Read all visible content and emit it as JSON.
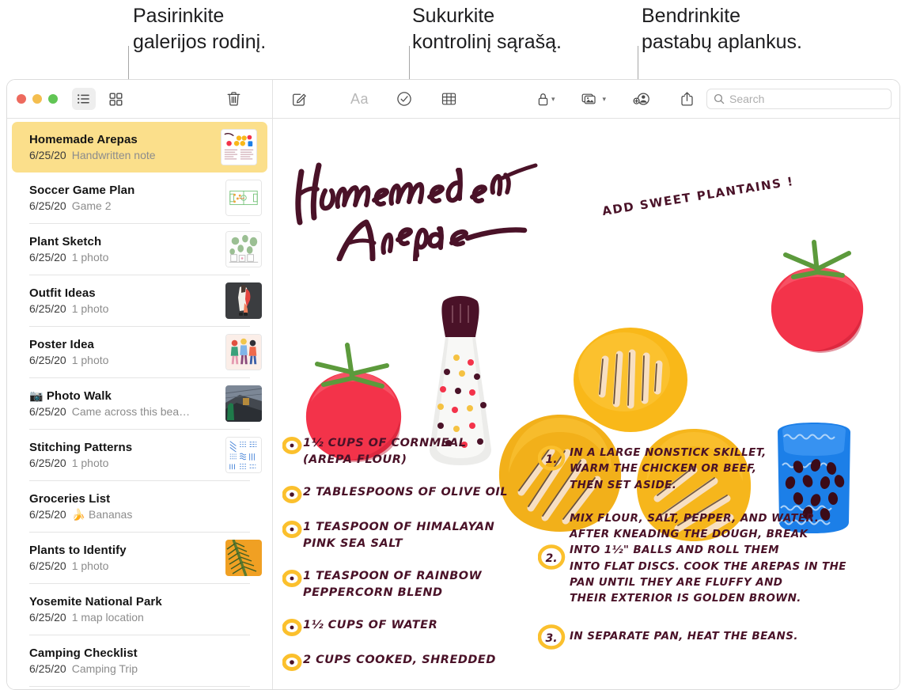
{
  "callouts": [
    {
      "id": "gallery",
      "text": "Pasirinkite\ngalerijos rodinį."
    },
    {
      "id": "checklist",
      "text": "Sukurkite\nkontrolinį sąrašą."
    },
    {
      "id": "share",
      "text": "Bendrinkite\npastabų aplankus."
    }
  ],
  "window": {
    "traffic_lights": [
      "close-red",
      "minimize-yellow",
      "zoom-green"
    ],
    "toolbar": {
      "list_view_label": "list-view",
      "gallery_view_label": "gallery-view",
      "delete_label": "delete-note",
      "compose_label": "new-note",
      "format_label": "Aa",
      "checklist_label": "checklist",
      "table_label": "table",
      "lock_label": "lock-note",
      "media_label": "media",
      "collaborate_label": "add-people",
      "share_label": "share",
      "search_placeholder": "Search",
      "search_value": ""
    }
  },
  "sidebar": {
    "notes": [
      {
        "title": "Homemade Arepas",
        "date": "6/25/20",
        "preview": "Handwritten note",
        "selected": true,
        "emoji": "",
        "thumb": "recipe"
      },
      {
        "title": "Soccer Game Plan",
        "date": "6/25/20",
        "preview": "Game 2",
        "selected": false,
        "emoji": "",
        "thumb": "soccer"
      },
      {
        "title": "Plant Sketch",
        "date": "6/25/20",
        "preview": "1 photo",
        "selected": false,
        "emoji": "",
        "thumb": "plants"
      },
      {
        "title": "Outfit Ideas",
        "date": "6/25/20",
        "preview": "1 photo",
        "selected": false,
        "emoji": "",
        "thumb": "outfit"
      },
      {
        "title": "Poster Idea",
        "date": "6/25/20",
        "preview": "1 photo",
        "selected": false,
        "emoji": "",
        "thumb": "poster"
      },
      {
        "title": "Photo Walk",
        "date": "6/25/20",
        "preview": "Came across this bea…",
        "selected": false,
        "emoji": "📷",
        "thumb": "photowalk"
      },
      {
        "title": "Stitching Patterns",
        "date": "6/25/20",
        "preview": "1 photo",
        "selected": false,
        "emoji": "",
        "thumb": "stitching"
      },
      {
        "title": "Groceries List",
        "date": "6/25/20",
        "preview": "Bananas",
        "selected": false,
        "emoji": "🍌",
        "thumb": ""
      },
      {
        "title": "Plants to Identify",
        "date": "6/25/20",
        "preview": "1 photo",
        "selected": false,
        "emoji": "",
        "thumb": "palm"
      },
      {
        "title": "Yosemite National Park",
        "date": "6/25/20",
        "preview": "1 map location",
        "selected": false,
        "emoji": "",
        "thumb": ""
      },
      {
        "title": "Camping Checklist",
        "date": "6/25/20",
        "preview": "Camping Trip",
        "selected": false,
        "emoji": "",
        "thumb": ""
      }
    ]
  },
  "note": {
    "title": "Homemade\nArepas",
    "annotation": "ADD SWEET\nPLANTAINS !",
    "ingredients": [
      "1½ CUPS OF CORNMEAL\n(AREPA FLOUR)",
      "2 TABLESPOONS OF OLIVE OIL",
      "1 TEASPOON OF HIMALAYAN\nPINK SEA SALT",
      "1 TEASPOON OF RAINBOW\nPEPPERCORN BLEND",
      "1½ CUPS OF WATER",
      "2 CUPS COOKED, SHREDDED"
    ],
    "steps": [
      {
        "num": "1.",
        "text": "IN A LARGE NONSTICK SKILLET,\nWARM THE CHICKEN OR BEEF,\nTHEN SET ASIDE."
      },
      {
        "num": "2.",
        "text": "MIX FLOUR, SALT, PEPPER, AND WATER.\nAFTER KNEADING THE DOUGH, BREAK\nINTO 1½\" BALLS AND ROLL THEM\nINTO FLAT DISCS. COOK THE AREPAS IN THE\nPAN UNTIL THEY ARE FLUFFY AND\nTHEIR EXTERIOR IS GOLDEN BROWN."
      },
      {
        "num": "3.",
        "text": "IN SEPARATE PAN, HEAT THE BEANS."
      }
    ],
    "illustrations": [
      "tomato",
      "pepper-grinder",
      "arepa",
      "arepa",
      "arepa",
      "arepa",
      "tomato",
      "bean-jar"
    ]
  },
  "colors": {
    "selected_row": "#FBDF8B",
    "ink": "#4A1228",
    "accent_yellow": "#FBC02D",
    "tomato_red": "#F3334A",
    "arepa_yellow": "#F9B819",
    "jar_blue": "#1C7FE8",
    "leaf_green": "#5C9A3C"
  }
}
